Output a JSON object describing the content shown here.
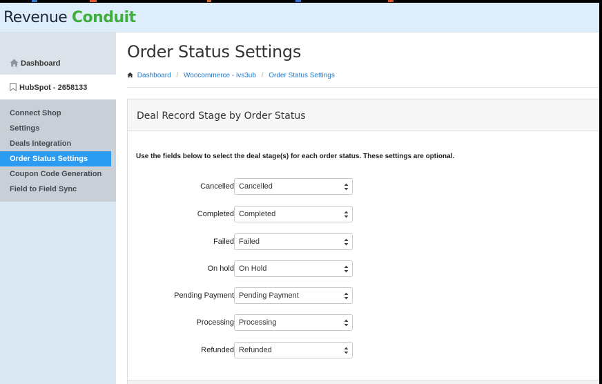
{
  "brand": {
    "part1": "Revenue",
    "part2": "Conduit"
  },
  "sidebar": {
    "dashboard_label": "Dashboard",
    "account_label": "HubSpot - 2658133",
    "items": [
      {
        "label": "Connect Shop"
      },
      {
        "label": "Settings"
      },
      {
        "label": "Deals Integration"
      },
      {
        "label": "Order Status Settings",
        "active": true
      },
      {
        "label": "Coupon Code Generation"
      },
      {
        "label": "Field to Field Sync"
      }
    ]
  },
  "main": {
    "title": "Order Status Settings",
    "breadcrumb": [
      "Dashboard",
      "Woocommerce - ivs3ub",
      "Order Status Settings"
    ],
    "breadcrumb_sep": "/",
    "panel": {
      "title": "Deal Record Stage by Order Status",
      "description": "Use the fields below to select the deal stage(s) for each order status. These settings are optional.",
      "rows": [
        {
          "label": "Cancelled",
          "value": "Cancelled"
        },
        {
          "label": "Completed",
          "value": "Completed"
        },
        {
          "label": "Failed",
          "value": "Failed"
        },
        {
          "label": "On hold",
          "value": "On Hold"
        },
        {
          "label": "Pending Payment",
          "value": "Pending Payment"
        },
        {
          "label": "Processing",
          "value": "Processing"
        },
        {
          "label": "Refunded",
          "value": "Refunded"
        }
      ]
    }
  },
  "icons": {
    "dashboard": "home-icon",
    "account": "bookmark-icon",
    "breadcrumb_home": "home-icon",
    "select": "updown-chevron-icon"
  },
  "colors": {
    "header_bg": "#ddeefa",
    "brand_green": "#3fae3d",
    "active_item": "#2b9cf2",
    "link": "#2277c8"
  }
}
